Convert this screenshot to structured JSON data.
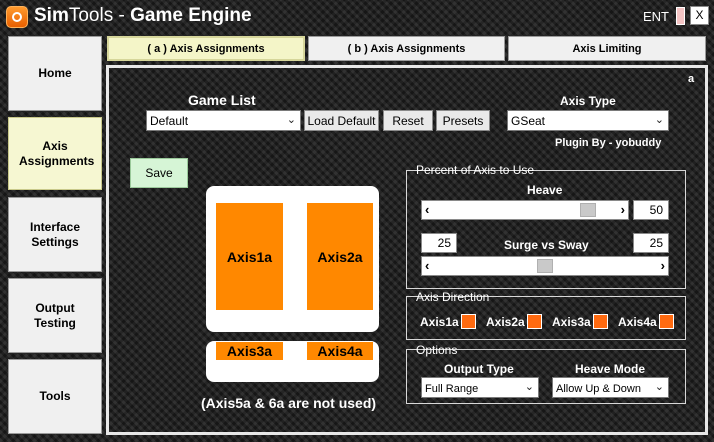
{
  "titlebar": {
    "app_name_light": "Sim",
    "app_name_rest": "Tools",
    "separator": " - ",
    "subtitle": "Game Engine",
    "ent_label": "ENT",
    "close_label": "X"
  },
  "sidebar": {
    "items": [
      {
        "label": "Home"
      },
      {
        "label": "Axis Assignments"
      },
      {
        "label": "Interface Settings"
      },
      {
        "label": "Output Testing"
      },
      {
        "label": "Tools"
      }
    ]
  },
  "tabs": [
    {
      "label": "( a ) Axis Assignments"
    },
    {
      "label": "( b ) Axis Assignments"
    },
    {
      "label": "Axis Limiting"
    }
  ],
  "panel": {
    "tag": "a",
    "game_list_label": "Game List",
    "game_list_value": "Default",
    "load_default_label": "Load Default",
    "reset_label": "Reset",
    "presets_label": "Presets",
    "axis_type_label": "Axis Type",
    "axis_type_value": "GSeat",
    "plugin_by": "Plugin By - yobuddy",
    "save_label": "Save",
    "axis_blocks": [
      "Axis1a",
      "Axis2a",
      "Axis3a",
      "Axis4a"
    ],
    "unused_note": "(Axis5a & 6a are not used)"
  },
  "percent_group": {
    "title": "Percent of Axis to Use",
    "heave_label": "Heave",
    "heave_value": "50",
    "heave_level": 0.9,
    "surge_sway_label": "Surge vs Sway",
    "surge_value": "25",
    "sway_value": "25",
    "surge_sway_level": 0.5
  },
  "direction_group": {
    "title": "Axis Direction",
    "axes": [
      "Axis1a",
      "Axis2a",
      "Axis3a",
      "Axis4a"
    ],
    "swatch_color": "#ff6a10"
  },
  "options_group": {
    "title": "Options",
    "output_type_label": "Output Type",
    "output_type_value": "Full Range",
    "heave_mode_label": "Heave Mode",
    "heave_mode_value": "Allow Up & Down"
  },
  "colors": {
    "accent_orange": "#ff8800",
    "active_tab": "#f4f5c8",
    "save_green": "#d6f5d6"
  }
}
